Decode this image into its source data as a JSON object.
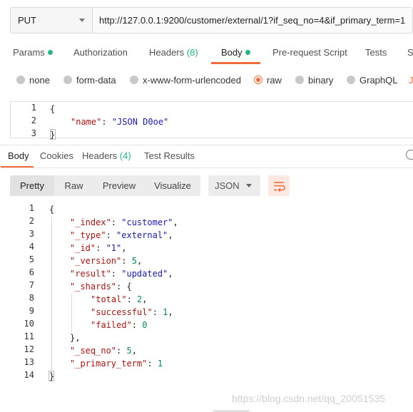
{
  "request": {
    "method": "PUT",
    "url": "http://127.0.0.1:9200/customer/external/1?if_seq_no=4&if_primary_term=1"
  },
  "request_tabs": {
    "params": "Params",
    "authorization": "Authorization",
    "headers": "Headers",
    "headers_count": "(8)",
    "body": "Body",
    "prerequest": "Pre-request Script",
    "tests": "Tests",
    "settings_cut": "S"
  },
  "body_types": {
    "none": "none",
    "form_data": "form-data",
    "urlencoded": "x-www-form-urlencoded",
    "raw": "raw",
    "binary": "binary",
    "graphql": "GraphQL",
    "json_cut": "JS"
  },
  "request_body": {
    "line_numbers": [
      "1",
      "2",
      "3"
    ],
    "open": "{",
    "key": "\"name\"",
    "colon": ": ",
    "value": "\"JSON D0oe\"",
    "close": "}"
  },
  "response_tabs": {
    "body": "Body",
    "cookies": "Cookies",
    "headers": "Headers",
    "headers_count": "(4)",
    "test_results": "Test Results"
  },
  "response_toolbar": {
    "pretty": "Pretty",
    "raw": "Raw",
    "preview": "Preview",
    "visualize": "Visualize",
    "format": "JSON"
  },
  "response_body": {
    "line_numbers": [
      "1",
      "2",
      "3",
      "4",
      "5",
      "6",
      "7",
      "8",
      "9",
      "10",
      "11",
      "12",
      "13",
      "14"
    ],
    "l1": "{",
    "l2_key": "\"_index\"",
    "l2_val": "\"customer\"",
    "l3_key": "\"_type\"",
    "l3_val": "\"external\"",
    "l4_key": "\"_id\"",
    "l4_val": "\"1\"",
    "l5_key": "\"_version\"",
    "l5_val": "5",
    "l6_key": "\"result\"",
    "l6_val": "\"updated\"",
    "l7_key": "\"_shards\"",
    "l7_val": "{",
    "l8_key": "\"total\"",
    "l8_val": "2",
    "l9_key": "\"successful\"",
    "l9_val": "1",
    "l10_key": "\"failed\"",
    "l10_val": "0",
    "l11": "},",
    "l12_key": "\"_seq_no\"",
    "l12_val": "5",
    "l13_key": "\"_primary_term\"",
    "l13_val": "1",
    "l14": "}"
  },
  "watermark": "https://blog.csdn.net/qq_20051535",
  "colors": {
    "accent": "#f26b3a",
    "green": "#26b47f",
    "json_key": "#a31515",
    "json_string": "#1a1aa6",
    "json_number": "#098658"
  }
}
